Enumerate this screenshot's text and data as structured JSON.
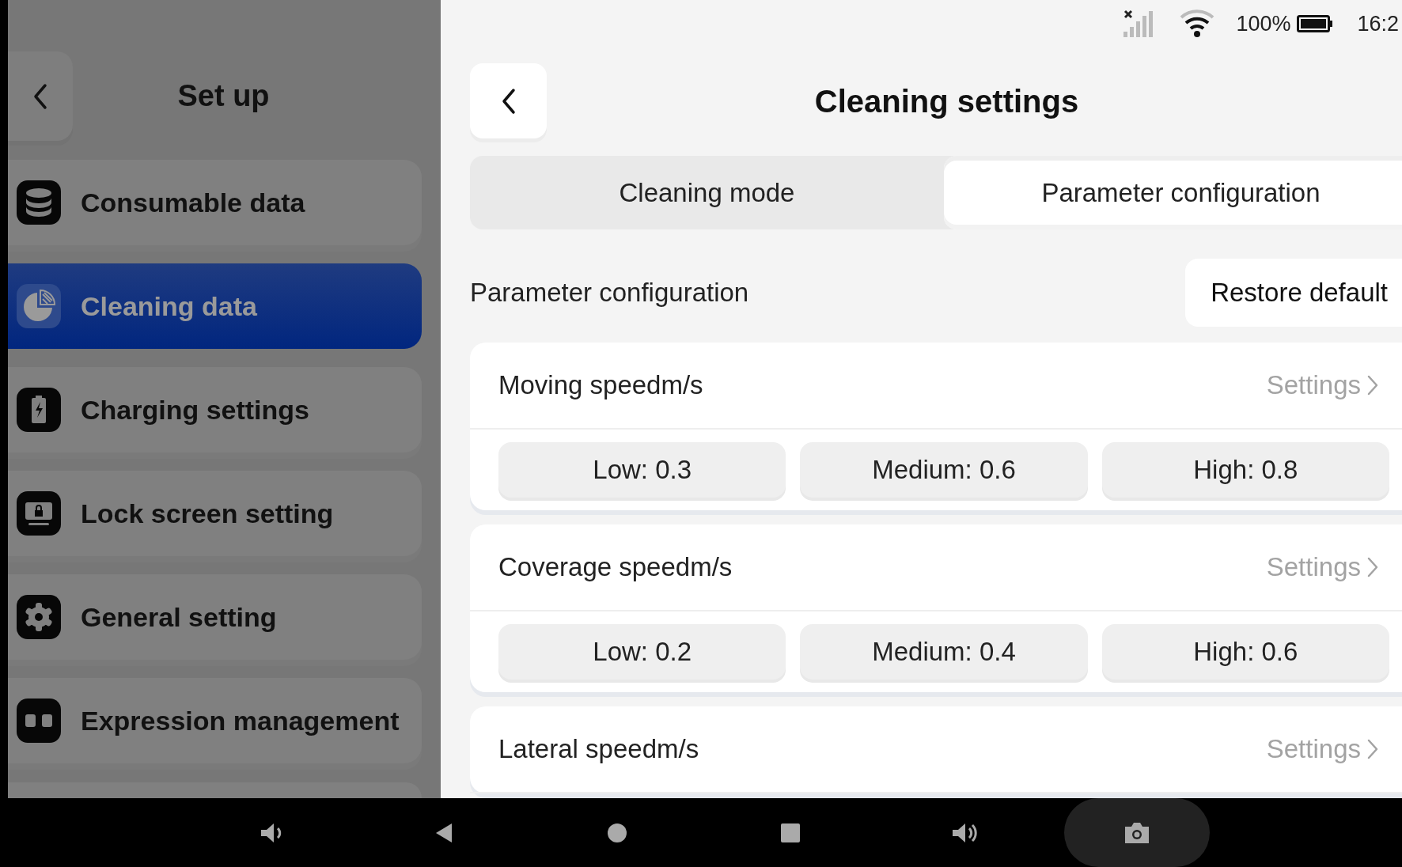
{
  "status_bar": {
    "battery": "100%",
    "time": "16:2"
  },
  "sidebar": {
    "title": "Set up",
    "items": [
      {
        "label": "Consumable data",
        "kind": "database",
        "selected": false
      },
      {
        "label": "Cleaning data",
        "kind": "pie",
        "selected": true
      },
      {
        "label": "Charging settings",
        "kind": "battery",
        "selected": false
      },
      {
        "label": "Lock screen setting",
        "kind": "lock",
        "selected": false
      },
      {
        "label": "General setting",
        "kind": "gear",
        "selected": false
      },
      {
        "label": "Expression management",
        "kind": "eyes",
        "selected": false
      }
    ]
  },
  "header": {
    "title": "Cleaning settings"
  },
  "tabs": [
    {
      "label": "Cleaning mode",
      "selected": false
    },
    {
      "label": "Parameter configuration",
      "selected": true
    }
  ],
  "section": {
    "title": "Parameter configuration",
    "button": "Restore default"
  },
  "parameters": [
    {
      "name": "Moving speedm/s",
      "action": "Settings",
      "levels": [
        "Low: 0.3",
        "Medium: 0.6",
        "High: 0.8"
      ]
    },
    {
      "name": "Coverage speedm/s",
      "action": "Settings",
      "levels": [
        "Low: 0.2",
        "Medium: 0.4",
        "High: 0.6"
      ]
    },
    {
      "name": "Lateral speedm/s",
      "action": "Settings"
    }
  ]
}
